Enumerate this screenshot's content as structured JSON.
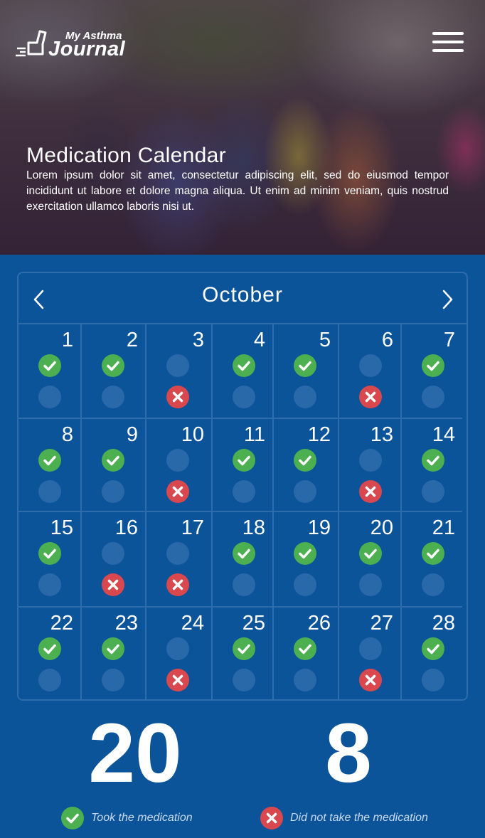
{
  "header": {
    "logo_small": "My Asthma",
    "logo_big": "Journal",
    "title": "Medication Calendar",
    "description": "Lorem ipsum dolor sit amet, consectetur adipiscing elit, sed do eiusmod tempor incididunt ut labore et dolore magna aliqua. Ut enim ad minim veniam, quis nostrud exercitation ullamco laboris nisi ut."
  },
  "calendar": {
    "month": "October",
    "days": [
      {
        "day": "1",
        "status": "took"
      },
      {
        "day": "2",
        "status": "took"
      },
      {
        "day": "3",
        "status": "missed"
      },
      {
        "day": "4",
        "status": "took"
      },
      {
        "day": "5",
        "status": "took"
      },
      {
        "day": "6",
        "status": "missed"
      },
      {
        "day": "7",
        "status": "took"
      },
      {
        "day": "8",
        "status": "took"
      },
      {
        "day": "9",
        "status": "took"
      },
      {
        "day": "10",
        "status": "missed"
      },
      {
        "day": "11",
        "status": "took"
      },
      {
        "day": "12",
        "status": "took"
      },
      {
        "day": "13",
        "status": "missed"
      },
      {
        "day": "14",
        "status": "took"
      },
      {
        "day": "15",
        "status": "took"
      },
      {
        "day": "16",
        "status": "missed"
      },
      {
        "day": "17",
        "status": "missed"
      },
      {
        "day": "18",
        "status": "took"
      },
      {
        "day": "19",
        "status": "took"
      },
      {
        "day": "20",
        "status": "took"
      },
      {
        "day": "21",
        "status": "took"
      },
      {
        "day": "22",
        "status": "took"
      },
      {
        "day": "23",
        "status": "took"
      },
      {
        "day": "24",
        "status": "missed"
      },
      {
        "day": "25",
        "status": "took"
      },
      {
        "day": "26",
        "status": "took"
      },
      {
        "day": "27",
        "status": "missed"
      },
      {
        "day": "28",
        "status": "took"
      }
    ]
  },
  "stats": {
    "took_count": "20",
    "missed_count": "8",
    "took_label": "Took the medication",
    "missed_label": "Did not take the medication"
  },
  "colors": {
    "background": "#0b5499",
    "took": "#4caf50",
    "missed": "#d9484e",
    "empty_marker": "#2a69a9"
  },
  "icons": {
    "menu": "hamburger-icon",
    "prev": "chevron-left-icon",
    "next": "chevron-right-icon",
    "took": "check-icon",
    "missed": "x-icon"
  }
}
